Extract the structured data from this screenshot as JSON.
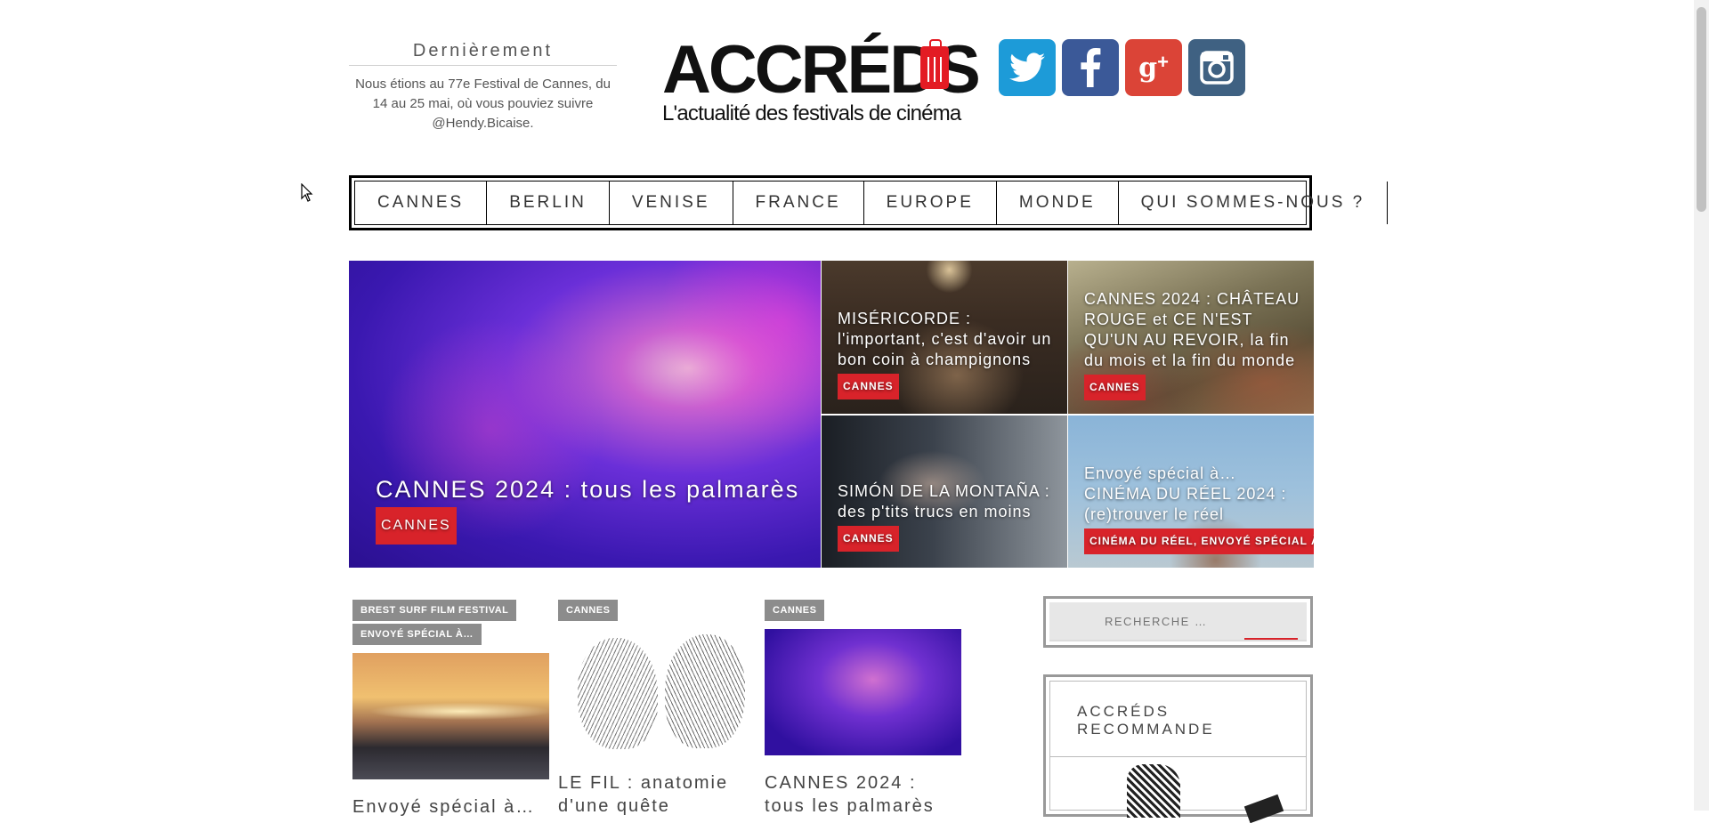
{
  "recent": {
    "title": "Dernièrement",
    "text": "Nous étions au 77e Festival de Cannes, du 14 au 25 mai, où vous pouviez suivre @Hendy.Bicaise."
  },
  "logo": {
    "word": "ACCRÉDS",
    "tagline": "L'actualité des festivals de cinéma",
    "brand_color": "#e31b23"
  },
  "social": [
    {
      "name": "twitter-icon",
      "glyph": "t",
      "color": "#1d9bd8"
    },
    {
      "name": "facebook-icon",
      "glyph": "f",
      "color": "#3b5998"
    },
    {
      "name": "google-plus-icon",
      "glyph": "g+",
      "color": "#db4437"
    },
    {
      "name": "instagram-icon",
      "glyph": "◎",
      "color": "#3f6182"
    }
  ],
  "nav": [
    "CANNES",
    "BERLIN",
    "VENISE",
    "FRANCE",
    "EUROPE",
    "MONDE",
    "QUI SOMMES-NOUS ?"
  ],
  "featured": {
    "main": {
      "title": "CANNES 2024 : tous les palmarès",
      "tag": "CANNES"
    },
    "tiles": [
      {
        "title": "MISÉRICORDE : l'important, c'est d'avoir un bon coin à champignons",
        "tag": "CANNES"
      },
      {
        "title": "CANNES 2024 : CHÂTEAU ROUGE et CE N'EST QU'UN AU REVOIR, la fin du mois et la fin du monde",
        "tag": "CANNES"
      },
      {
        "title": "SIMÓN DE LA MONTAÑA : des p'tits trucs en moins",
        "tag": "CANNES"
      },
      {
        "title": "Envoyé spécial à… CINÉMA DU RÉEL 2024 : (re)trouver le réel",
        "tag": "CINÉMA DU RÉEL, ENVOYÉ SPÉCIAL À…"
      }
    ]
  },
  "posts": [
    {
      "tags": [
        "BREST SURF FILM FESTIVAL",
        "ENVOYÉ SPÉCIAL À…"
      ],
      "title": "Envoyé spécial à…"
    },
    {
      "tags": [
        "CANNES"
      ],
      "title": "LE FIL : anatomie d'une quête"
    },
    {
      "tags": [
        "CANNES"
      ],
      "title": "CANNES 2024 : tous les palmarès"
    }
  ],
  "sidebar": {
    "search_placeholder": "RECHERCHE …",
    "reco_title": "ACCRÉDS RECOMMANDE"
  }
}
